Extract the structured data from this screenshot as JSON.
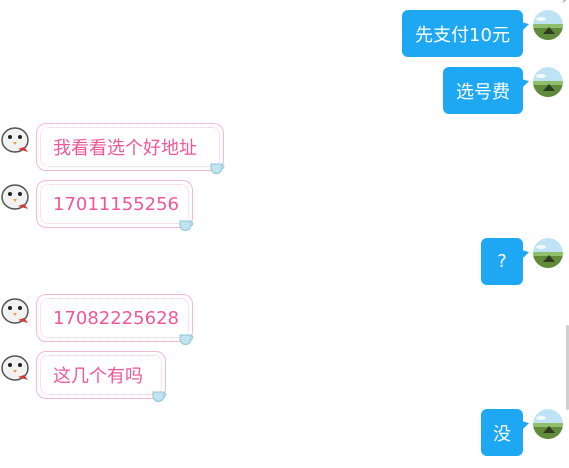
{
  "messages": [
    {
      "side": "self",
      "text": "先支付10元"
    },
    {
      "side": "self",
      "text": "选号费"
    },
    {
      "side": "other",
      "text": "我看看选个好地址"
    },
    {
      "side": "other",
      "text": "17011155256"
    },
    {
      "side": "self",
      "text": "?"
    },
    {
      "side": "other",
      "text": "17082225628"
    },
    {
      "side": "other",
      "text": "这几个有吗"
    },
    {
      "side": "self",
      "text": "没"
    }
  ],
  "colors": {
    "self_bubble": "#1ea7f3",
    "other_text": "#f0579a",
    "other_border": "#f5b9d4"
  },
  "icons": {
    "self_avatar": "landscape-avatar-icon",
    "other_avatar": "cartoon-bird-avatar-icon",
    "bubble_decoration": "teacup-icon"
  }
}
